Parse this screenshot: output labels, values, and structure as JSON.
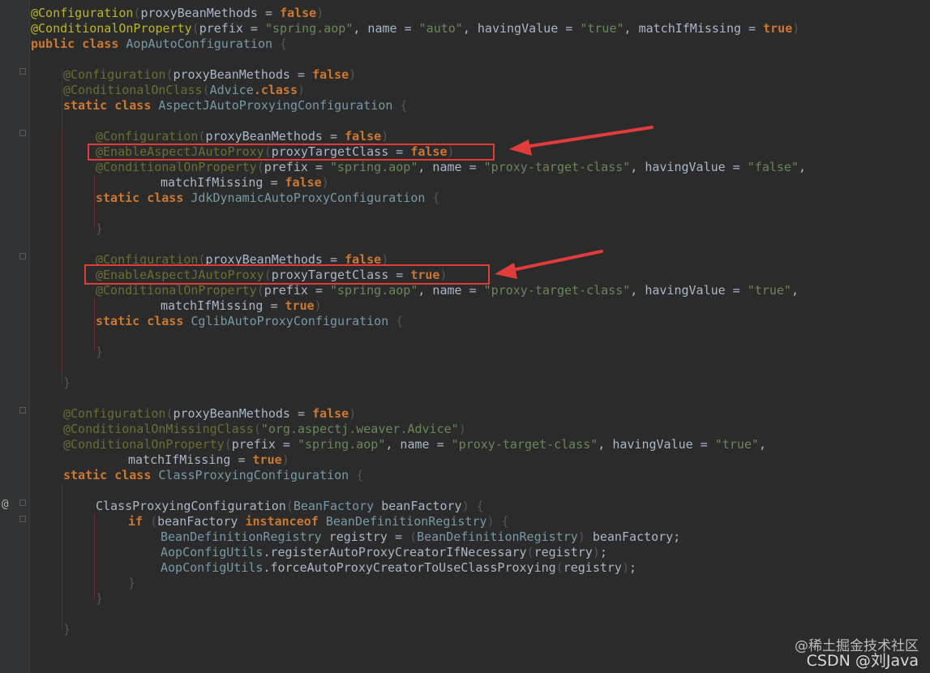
{
  "code": {
    "l1": {
      "a1": "@Configuration",
      "p1": "(",
      "p2": "proxyBeanMethods = ",
      "k1": "false",
      "p3": ")"
    },
    "l2": {
      "a1": "@ConditionalOnProperty",
      "p1": "(",
      "p2": "prefix = ",
      "s1": "\"spring.aop\"",
      "p3": ", name = ",
      "s2": "\"auto\"",
      "p4": ", havingValue = ",
      "s3": "\"true\"",
      "p5": ", matchIfMissing = ",
      "k1": "true",
      "p6": ")"
    },
    "l3": {
      "k1": "public class ",
      "c1": "AopAutoConfiguration",
      "p1": " {"
    },
    "l5": {
      "a1": "@Configuration",
      "p1": "(",
      "p2": "proxyBeanMethods = ",
      "k1": "false",
      "p3": ")"
    },
    "l6": {
      "a1": "@ConditionalOnClass",
      "p1": "(",
      "c1": "Advice",
      "k1": ".class",
      "p2": ")"
    },
    "l7": {
      "k1": "static class ",
      "c1": "AspectJAutoProxyingConfiguration",
      "p1": " {"
    },
    "l9": {
      "a1": "@Configuration",
      "p1": "(",
      "p2": "proxyBeanMethods = ",
      "k1": "false",
      "p3": ")"
    },
    "l10": {
      "a1": "@EnableAspectJAutoProxy",
      "p1": "(",
      "p2": "proxyTargetClass = ",
      "k1": "false",
      "p3": ")"
    },
    "l11": {
      "a1": "@ConditionalOnProperty",
      "p1": "(",
      "p2": "prefix = ",
      "s1": "\"spring.aop\"",
      "p3": ", name = ",
      "s2": "\"proxy-target-class\"",
      "p4": ", havingValue = ",
      "s3": "\"false\"",
      "p5": ","
    },
    "l12": {
      "p1": "matchIfMissing = ",
      "k1": "false",
      "p2": ")"
    },
    "l13": {
      "k1": "static class ",
      "c1": "JdkDynamicAutoProxyConfiguration",
      "p1": " {"
    },
    "l15": {
      "p1": "}"
    },
    "l17": {
      "a1": "@Configuration",
      "p1": "(",
      "p2": "proxyBeanMethods = ",
      "k1": "false",
      "p3": ")"
    },
    "l18": {
      "a1": "@EnableAspectJAutoProxy",
      "p1": "(",
      "p2": "proxyTargetClass = ",
      "k1": "true",
      "p3": ")"
    },
    "l19": {
      "a1": "@ConditionalOnProperty",
      "p1": "(",
      "p2": "prefix = ",
      "s1": "\"spring.aop\"",
      "p3": ", name = ",
      "s2": "\"proxy-target-class\"",
      "p4": ", havingValue = ",
      "s3": "\"true\"",
      "p5": ","
    },
    "l20": {
      "p1": "matchIfMissing = ",
      "k1": "true",
      "p2": ")"
    },
    "l21": {
      "k1": "static class ",
      "c1": "CglibAutoProxyConfiguration",
      "p1": " {"
    },
    "l23": {
      "p1": "}"
    },
    "l25": {
      "p1": "}"
    },
    "l27": {
      "a1": "@Configuration",
      "p1": "(",
      "p2": "proxyBeanMethods = ",
      "k1": "false",
      "p3": ")"
    },
    "l28": {
      "a1": "@ConditionalOnMissingClass",
      "p1": "(",
      "s1": "\"org.aspectj.weaver.Advice\"",
      "p2": ")"
    },
    "l29": {
      "a1": "@ConditionalOnProperty",
      "p1": "(",
      "p2": "prefix = ",
      "s1": "\"spring.aop\"",
      "p3": ", name = ",
      "s2": "\"proxy-target-class\"",
      "p4": ", havingValue = ",
      "s3": "\"true\"",
      "p5": ","
    },
    "l30": {
      "p1": "matchIfMissing = ",
      "k1": "true",
      "p2": ")"
    },
    "l31": {
      "k1": "static class ",
      "c1": "ClassProxyingConfiguration",
      "p1": " {"
    },
    "l33": {
      "p1": "ClassProxyingConfiguration",
      "p2": "(",
      "c1": "BeanFactory",
      "p3": " beanFactory",
      "p4": ") {"
    },
    "l34": {
      "k1": "if ",
      "p1": "(",
      "p2": "beanFactory ",
      "k2": "instanceof ",
      "c1": "BeanDefinitionRegistry",
      "p3": ") {"
    },
    "l35": {
      "c1": "BeanDefinitionRegistry",
      "p1": " registry = ",
      "p2": "(",
      "c2": "BeanDefinitionRegistry",
      "p3": ")",
      "p4": " beanFactory;"
    },
    "l36": {
      "c1": "AopConfigUtils",
      "p1": ".registerAutoProxyCreatorIfNecessary",
      "p2": "(",
      "p3": "registry",
      "p4": ")",
      "p5": ";"
    },
    "l37": {
      "c1": "AopConfigUtils",
      "p1": ".forceAutoProxyCreatorToUseClassProxying",
      "p2": "(",
      "p3": "registry",
      "p4": ")",
      "p5": ";"
    },
    "l38": {
      "p1": "}"
    },
    "l39": {
      "p1": "}"
    },
    "l41": {
      "p1": "}"
    }
  },
  "gutter": {
    "override_marker": "@"
  },
  "watermark": {
    "line1": "@稀土掘金技术社区",
    "line2": "CSDN @刘Java"
  },
  "colors": {
    "annotation": "#bbb529",
    "keyword": "#cc7832",
    "string": "#6a8759",
    "class_ref": "#769aa5",
    "plain": "#a9b7c6",
    "background": "#2b2b2b",
    "highlight_box": "#e03c3c"
  }
}
